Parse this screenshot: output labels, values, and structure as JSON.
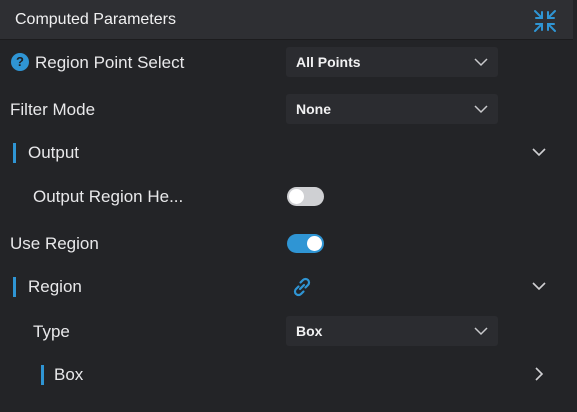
{
  "panel": {
    "title": "Computed Parameters",
    "collapse_icon": "collapse-arrows-icon"
  },
  "rows": {
    "region_point_select": {
      "label": "Region Point Select",
      "value": "All Points",
      "help_icon": "?"
    },
    "filter_mode": {
      "label": "Filter Mode",
      "value": "None"
    },
    "output": {
      "label": "Output",
      "expanded": true
    },
    "output_region_height": {
      "label": "Output Region He...",
      "enabled": false
    },
    "use_region": {
      "label": "Use Region",
      "enabled": true
    },
    "region": {
      "label": "Region",
      "link_icon": "link-icon",
      "expanded": true
    },
    "type": {
      "label": "Type",
      "value": "Box"
    },
    "box": {
      "label": "Box",
      "expanded": false
    }
  },
  "colors": {
    "accent": "#2f95d4",
    "background": "#232427",
    "header": "#2e2f33",
    "select_bg": "#2b2c30",
    "text": "#e8e8ea"
  }
}
